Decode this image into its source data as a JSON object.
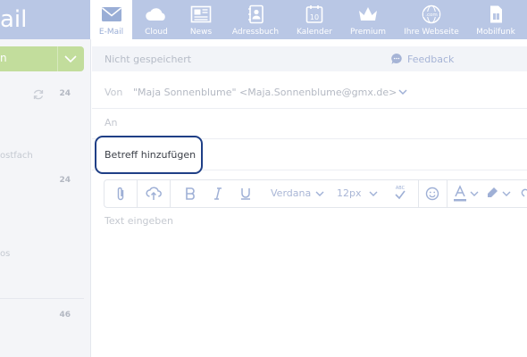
{
  "brand": {
    "text": "ail"
  },
  "nav": [
    {
      "label": "E-Mail",
      "icon": "envelope-icon",
      "active": true
    },
    {
      "label": "Cloud",
      "icon": "cloud-icon"
    },
    {
      "label": "News",
      "icon": "news-icon"
    },
    {
      "label": "Adressbuch",
      "icon": "address-book-icon"
    },
    {
      "label": "Kalender",
      "icon": "calendar-icon",
      "badge": "10"
    },
    {
      "label": "Premium",
      "icon": "crown-icon"
    },
    {
      "label": "Ihre Webseite",
      "icon": "globe-icon",
      "badge": ".com"
    },
    {
      "label": "Mobilfunk",
      "icon": "sim-card-icon"
    }
  ],
  "sidebar": {
    "compose_label": "n",
    "inbox_count": "24",
    "folder_label": "ostfach",
    "folder_count": "24",
    "misc_label": "os",
    "bottom_count": "46"
  },
  "compose": {
    "status": "Nicht gespeichert",
    "feedback": "Feedback",
    "from_label": "Von",
    "from_value": "\"Maja Sonnenblume\" <Maja.Sonnenblume@gmx.de>",
    "to_label": "An",
    "subject_placeholder": "Betreff hinzufügen",
    "body_placeholder": "Text eingeben"
  },
  "toolbar": {
    "font": "Verdana",
    "size": "12px",
    "spell_label": "ABC"
  },
  "colors": {
    "topbar": "#b9c7e5",
    "accent": "#9aaed6",
    "compose_button": "#c2dd9c",
    "subject_focus": "#1f3f86"
  }
}
